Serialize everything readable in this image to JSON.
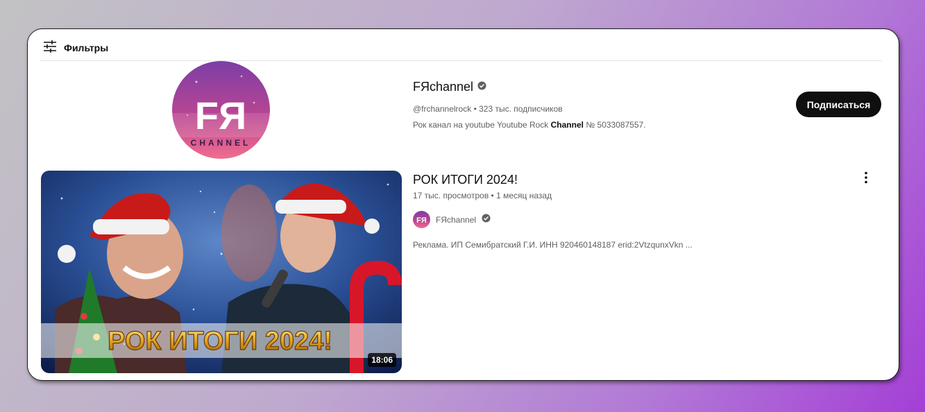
{
  "filters": {
    "label": "Фильтры",
    "icon": "sliders-icon"
  },
  "channel": {
    "name": "FЯchannel",
    "verified_icon": "verified-check-icon",
    "avatar_logo_text": "FЯ",
    "avatar_logo_subtext": "CHANNEL",
    "handle": "@frchannelrock",
    "separator": "•",
    "subscribers": "323 тыс. подписчиков",
    "description_prefix": "Рок канал на youtube Youtube Rock ",
    "description_bold": "Channel",
    "description_suffix": " № 5033087557.",
    "subscribe_label": "Подписаться"
  },
  "video": {
    "title": "РОК ИТОГИ 2024!",
    "thumbnail_text": "РОК ИТОГИ 2024!",
    "views": "17 тыс. просмотров",
    "separator": "•",
    "age": "1 месяц назад",
    "channel_name": "FЯchannel",
    "duration": "18:06",
    "description": "Реклама. ИП Семибратский Г.И. ИНН 920460148187 erid:2VtzqunxVkn ...",
    "more_icon": "more-vertical-icon"
  },
  "colors": {
    "accent": "#0f0f0f",
    "meta": "#606060",
    "avatar_pink": "#e0508a",
    "avatar_purple": "#7a3fa8"
  }
}
